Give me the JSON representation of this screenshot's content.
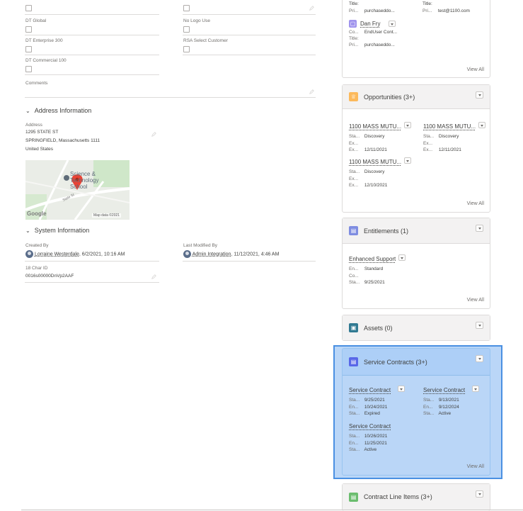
{
  "left": {
    "fields": {
      "dt_global": "DT Global",
      "dt_enterprise_300": "DT Enterprise 300",
      "dt_commercial_100": "DT Commercial 100",
      "no_logo_use": "No Logo Use",
      "rsa_select_customer": "RSA Select Customer",
      "comments": "Comments"
    },
    "address": {
      "section_title": "Address Information",
      "label": "Address",
      "line1": "1295 STATE ST",
      "line2": "SPRINGFIELD, Massachusetts 1111",
      "line3": "United States",
      "map_school": "Science & Technology School",
      "map_road": "State St",
      "map_logo": "Google",
      "map_data": "Map data ©2021"
    },
    "system": {
      "section_title": "System Information",
      "created_by_label": "Created By",
      "created_by_name": "Lorraine Westerdale",
      "created_by_date": ", 6/2/2021, 10:16 AM",
      "last_modified_label": "Last Modified By",
      "last_modified_name": "Admin Integration",
      "last_modified_date": ", 11/12/2021, 4:46 AM",
      "char_id_label": "18 Char ID",
      "char_id_value": "0016s00000DnVp2AAF"
    }
  },
  "contacts_card": {
    "row1_title_a": "Title:",
    "row1_title_b": "Title:",
    "row1_pri_a_key": "Pri...",
    "row1_pri_a_val": "purchaseddo...",
    "row1_pri_b_key": "Pri...",
    "row1_pri_b_val": "test@1100.com",
    "contact_name": "Dan Fry",
    "co_key": "Co...",
    "co_val": "EndUser Cont...",
    "title_key": "Title:",
    "pri_key": "Pri...",
    "pri_val": "purchaseddo...",
    "view_all": "View All"
  },
  "opportunities": {
    "title": "Opportunities (3+)",
    "items": [
      {
        "name": "1100 MASS MUTU...",
        "sta": "Discovery",
        "ex1": "",
        "ex2": "12/11/2021"
      },
      {
        "name": "1100 MASS MUTU...",
        "sta": "Discovery",
        "ex1": "",
        "ex2": "12/11/2021"
      },
      {
        "name": "1100 MASS MUTU...",
        "sta": "Discovery",
        "ex1": "",
        "ex2": "12/10/2021"
      }
    ],
    "k_sta": "Sta...",
    "k_ex": "Ex...",
    "view_all": "View All"
  },
  "entitlements": {
    "title": "Entitlements (1)",
    "item_name": "Enhanced Support",
    "en_key": "En...",
    "en_val": "Standard",
    "co_key": "Co...",
    "sta_key": "Sta...",
    "sta_val": "9/25/2021",
    "view_all": "View All"
  },
  "assets": {
    "title": "Assets (0)"
  },
  "service_contracts": {
    "title": "Service Contracts (3+)",
    "items": [
      {
        "name": "Service Contract",
        "start": "9/25/2021",
        "end": "10/24/2021",
        "status": "Expired"
      },
      {
        "name": "Service Contract",
        "start": "9/13/2021",
        "end": "9/12/2024",
        "status": "Active"
      },
      {
        "name": "Service Contract",
        "start": "10/26/2021",
        "end": "11/25/2021",
        "status": "Active"
      }
    ],
    "k_sta": "Sta...",
    "k_en": "En...",
    "view_all": "View All"
  },
  "contract_line_items": {
    "title": "Contract Line Items (3+)"
  },
  "colors": {
    "opportunities_icon": "#fcb95b",
    "entitlements_icon": "#7f8de1",
    "assets_icon": "#317a92",
    "service_contracts_icon": "#5867e8",
    "contract_line_items_icon": "#6bbd6e",
    "selection": "#4a90e2"
  }
}
